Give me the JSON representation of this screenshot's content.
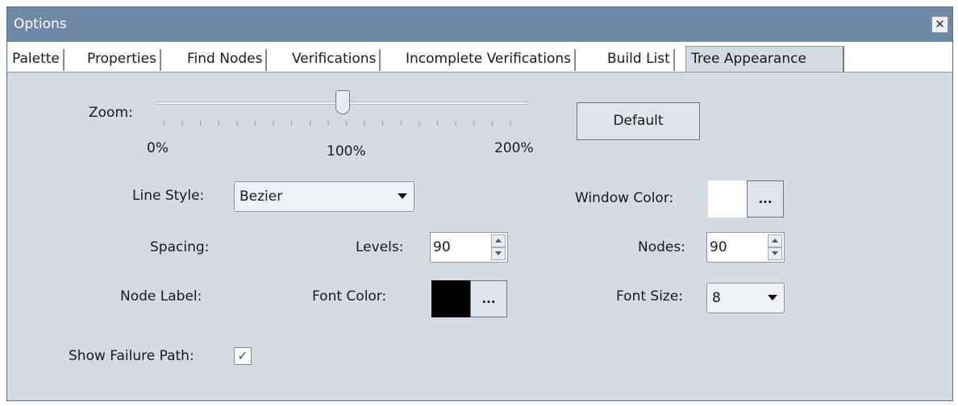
{
  "window": {
    "title": "Options",
    "close_glyph": "✕"
  },
  "tabs": [
    {
      "label": "Palette"
    },
    {
      "label": "Properties"
    },
    {
      "label": "Find Nodes"
    },
    {
      "label": "Verifications"
    },
    {
      "label": "Incomplete Verifications"
    },
    {
      "label": "Build List"
    },
    {
      "label": "Tree Appearance",
      "active": true
    }
  ],
  "zoom": {
    "label": "Zoom:",
    "min_label": "0%",
    "mid_label": "100%",
    "max_label": "200%",
    "value_percent": 100
  },
  "default_button": "Default",
  "line_style": {
    "label": "Line Style:",
    "value": "Bezier"
  },
  "window_color": {
    "label": "Window Color:",
    "color": "#ffffff",
    "button": "..."
  },
  "spacing": {
    "label": "Spacing:",
    "levels_label": "Levels:",
    "levels_value": "90",
    "nodes_label": "Nodes:",
    "nodes_value": "90"
  },
  "node_label": {
    "label": "Node Label:",
    "font_color_label": "Font Color:",
    "font_color": "#000000",
    "font_color_button": "...",
    "font_size_label": "Font Size:",
    "font_size_value": "8"
  },
  "show_failure_path": {
    "label": "Show Failure Path:",
    "checked": true,
    "check_glyph": "✓"
  },
  "colors": {
    "title_bar": "#7088a8",
    "panel_bg": "#d5dbe3"
  }
}
